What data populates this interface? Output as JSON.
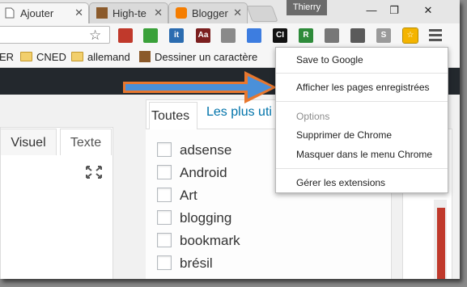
{
  "tabs": [
    {
      "title": "Ajouter",
      "active": true
    },
    {
      "title": "High-te",
      "active": false
    },
    {
      "title": "Blogger",
      "active": false
    }
  ],
  "window": {
    "user": "Thierry",
    "minimize": "—",
    "maximize": "❐",
    "close": "✕"
  },
  "toolbar": {
    "bookmark_star": "☆",
    "extensions": [
      {
        "icon": "bookmark-red-icon",
        "label": "",
        "color": "#c0392b"
      },
      {
        "icon": "refresh-green-icon",
        "label": "",
        "color": "#3aa13a"
      },
      {
        "icon": "it-icon",
        "label": "it",
        "color": "#2b6cb0"
      },
      {
        "icon": "aa-icon",
        "label": "Aa",
        "color": "#7b1f1f"
      },
      {
        "icon": "window-icon",
        "label": "",
        "color": "#8a8a8a"
      },
      {
        "icon": "translate-icon",
        "label": "",
        "color": "#3d7de0"
      },
      {
        "icon": "ci-icon",
        "label": "CI",
        "color": "#111111"
      },
      {
        "icon": "r-icon",
        "label": "R",
        "color": "#2e8b3a"
      },
      {
        "icon": "image-icon",
        "label": "",
        "color": "#777777"
      },
      {
        "icon": "search-ext-icon",
        "label": "",
        "color": "#5a5a5a"
      },
      {
        "icon": "skype-icon",
        "label": "S",
        "color": "#9a9a9a"
      },
      {
        "icon": "save-to-google-icon",
        "label": "☆",
        "color": "#f4b400"
      }
    ]
  },
  "bookmarks": {
    "items": [
      {
        "label": "ER",
        "type": "text"
      },
      {
        "label": "CNED",
        "type": "folder"
      },
      {
        "label": "allemand",
        "type": "folder"
      },
      {
        "label": "Dessiner un caractère",
        "type": "page"
      }
    ]
  },
  "editor": {
    "tab_visual": "Visuel",
    "tab_text": "Texte"
  },
  "categories": {
    "tab_all": "Toutes",
    "tab_popular": "Les plus uti",
    "items": [
      "adsense",
      "Android",
      "Art",
      "blogging",
      "bookmark",
      "brésil"
    ]
  },
  "menu": {
    "items": [
      {
        "label": "Save to Google",
        "type": "item"
      },
      {
        "label": "Afficher les pages enregistrées",
        "type": "item"
      },
      {
        "label": "Options",
        "type": "header"
      },
      {
        "label": "Supprimer de Chrome",
        "type": "item"
      },
      {
        "label": "Masquer dans le menu Chrome",
        "type": "item"
      },
      {
        "label": "Gérer les extensions",
        "type": "item"
      }
    ]
  },
  "colors": {
    "arrow_fill": "#4a90d9",
    "arrow_outline": "#e8772e",
    "wp_adminbar": "#23282d",
    "link": "#0073aa"
  }
}
